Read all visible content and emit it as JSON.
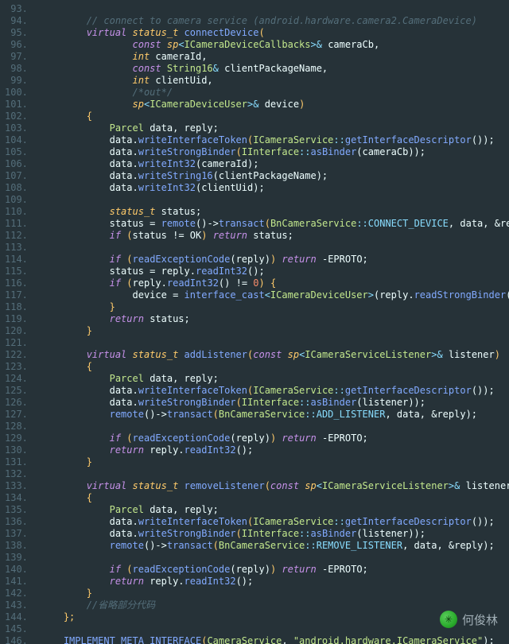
{
  "gutter": {
    "start": 93,
    "end": 146
  },
  "watermark": {
    "author": "何俊林",
    "icon_label": "wechat"
  },
  "code": {
    "l93": {
      "i": 2
    },
    "l94": {
      "i": 2,
      "cm": "// connect to camera service (android.hardware.camera2.CameraDevice)"
    },
    "l95": {
      "i": 2,
      "kw": "virtual ",
      "ty": "status_t ",
      "fn": "connectDevice",
      "pn": "("
    },
    "l96": {
      "i": 4,
      "kw": "const ",
      "ty": "sp",
      "pn1": "<",
      "cl": "ICameraDeviceCallbacks",
      "pn2": ">& ",
      "id": "cameraCb,",
      "trail": ""
    },
    "l97": {
      "i": 4,
      "ty": "int ",
      "id": "cameraId,"
    },
    "l98": {
      "i": 4,
      "kw": "const ",
      "cl": "String16",
      "pn": "& ",
      "id": "clientPackageName,"
    },
    "l99": {
      "i": 4,
      "ty": "int ",
      "id": "clientUid,"
    },
    "l100": {
      "i": 4,
      "cm": "/*out*/"
    },
    "l101": {
      "i": 4,
      "ty": "sp",
      "pn1": "<",
      "cl": "ICameraDeviceUser",
      "pn2": ">& ",
      "id": "device",
      "close": ")"
    },
    "l102": {
      "i": 2,
      "br": "{"
    },
    "l103": {
      "i": 3,
      "cl": "Parcel ",
      "id": "data, reply;"
    },
    "l104": {
      "i": 3,
      "a": "data.",
      "fn": "writeInterfaceToken",
      "op": "(",
      "cl": "ICameraService",
      "sc": "::",
      "fn2": "getInterfaceDescriptor",
      "rest": "());"
    },
    "l105": {
      "i": 3,
      "a": "data.",
      "fn": "writeStrongBinder",
      "op": "(",
      "cl": "IInterface",
      "sc": "::",
      "fn2": "asBinder",
      "rest": "(cameraCb));"
    },
    "l106": {
      "i": 3,
      "a": "data.",
      "fn": "writeInt32",
      "rest": "(cameraId);"
    },
    "l107": {
      "i": 3,
      "a": "data.",
      "fn": "writeString16",
      "rest": "(clientPackageName);"
    },
    "l108": {
      "i": 3,
      "a": "data.",
      "fn": "writeInt32",
      "rest": "(clientUid);"
    },
    "l109": {
      "i": 3
    },
    "l110": {
      "i": 3,
      "ty": "status_t ",
      "id": "status;"
    },
    "l111": {
      "i": 3,
      "a": "status = ",
      "fn": "remote",
      "mid": "()->",
      "fn2": "transact",
      "op": "(",
      "cl": "BnCameraService",
      "sc": "::",
      "cc": "CONNECT_DEVICE",
      "rest": ", data, &reply);"
    },
    "l112": {
      "i": 3,
      "kw": "if ",
      "op": "(",
      "id": "status != OK",
      "cp": ") ",
      "kw2": "return ",
      "ret": "status;"
    },
    "l113": {
      "i": 3
    },
    "l114": {
      "i": 3,
      "kw": "if ",
      "op": "(",
      "fn": "readExceptionCode",
      "mid": "(reply)",
      "cp": ") ",
      "kw2": "return ",
      "ret": "-EPROTO;"
    },
    "l115": {
      "i": 3,
      "a": "status = reply.",
      "fn": "readInt32",
      "rest": "();"
    },
    "l116": {
      "i": 3,
      "kw": "if ",
      "op": "(",
      "a": "reply.",
      "fn": "readInt32",
      "mid": "() != ",
      "num": "0",
      "cp": ") {"
    },
    "l117": {
      "i": 4,
      "a": "device = ",
      "fn": "interface_cast",
      "pn1": "<",
      "cl": "ICameraDeviceUser",
      "pn2": ">",
      "mid": "(reply.",
      "fn2": "readStrongBinder",
      "rest": "());"
    },
    "l118": {
      "i": 3,
      "br": "}"
    },
    "l119": {
      "i": 3,
      "kw": "return ",
      "id": "status;"
    },
    "l120": {
      "i": 2,
      "br": "}"
    },
    "l121": {
      "i": 2
    },
    "l122": {
      "i": 2,
      "kw": "virtual ",
      "ty": "status_t ",
      "fn": "addListener",
      "op": "(",
      "kw2": "const ",
      "ty2": "sp",
      "pn1": "<",
      "cl": "ICameraServiceListener",
      "pn2": ">& ",
      "id": "listener",
      "cp": ")"
    },
    "l123": {
      "i": 2,
      "br": "{"
    },
    "l124": {
      "i": 3,
      "cl": "Parcel ",
      "id": "data, reply;"
    },
    "l125": {
      "i": 3,
      "a": "data.",
      "fn": "writeInterfaceToken",
      "op": "(",
      "cl": "ICameraService",
      "sc": "::",
      "fn2": "getInterfaceDescriptor",
      "rest": "());"
    },
    "l126": {
      "i": 3,
      "a": "data.",
      "fn": "writeStrongBinder",
      "op": "(",
      "cl": "IInterface",
      "sc": "::",
      "fn2": "asBinder",
      "rest": "(listener));"
    },
    "l127": {
      "i": 3,
      "fn": "remote",
      "mid": "()->",
      "fn2": "transact",
      "op": "(",
      "cl": "BnCameraService",
      "sc": "::",
      "cc": "ADD_LISTENER",
      "rest": ", data, &reply);"
    },
    "l128": {
      "i": 3
    },
    "l129": {
      "i": 3,
      "kw": "if ",
      "op": "(",
      "fn": "readExceptionCode",
      "mid": "(reply)",
      "cp": ") ",
      "kw2": "return ",
      "ret": "-EPROTO;"
    },
    "l130": {
      "i": 3,
      "kw": "return ",
      "a": "reply.",
      "fn": "readInt32",
      "rest": "();"
    },
    "l131": {
      "i": 2,
      "br": "}"
    },
    "l132": {
      "i": 2
    },
    "l133": {
      "i": 2,
      "kw": "virtual ",
      "ty": "status_t ",
      "fn": "removeListener",
      "op": "(",
      "kw2": "const ",
      "ty2": "sp",
      "pn1": "<",
      "cl": "ICameraServiceListener",
      "pn2": ">& ",
      "id": "listener",
      "cp": ")"
    },
    "l134": {
      "i": 2,
      "br": "{"
    },
    "l135": {
      "i": 3,
      "cl": "Parcel ",
      "id": "data, reply;"
    },
    "l136": {
      "i": 3,
      "a": "data.",
      "fn": "writeInterfaceToken",
      "op": "(",
      "cl": "ICameraService",
      "sc": "::",
      "fn2": "getInterfaceDescriptor",
      "rest": "());"
    },
    "l137": {
      "i": 3,
      "a": "data.",
      "fn": "writeStrongBinder",
      "op": "(",
      "cl": "IInterface",
      "sc": "::",
      "fn2": "asBinder",
      "rest": "(listener));"
    },
    "l138": {
      "i": 3,
      "fn": "remote",
      "mid": "()->",
      "fn2": "transact",
      "op": "(",
      "cl": "BnCameraService",
      "sc": "::",
      "cc": "REMOVE_LISTENER",
      "rest": ", data, &reply);"
    },
    "l139": {
      "i": 3
    },
    "l140": {
      "i": 3,
      "kw": "if ",
      "op": "(",
      "fn": "readExceptionCode",
      "mid": "(reply)",
      "cp": ") ",
      "kw2": "return ",
      "ret": "-EPROTO;"
    },
    "l141": {
      "i": 3,
      "kw": "return ",
      "a": "reply.",
      "fn": "readInt32",
      "rest": "();"
    },
    "l142": {
      "i": 2,
      "br": "}"
    },
    "l143": {
      "i": 2,
      "cm": "//省略部分代码"
    },
    "l144": {
      "i": 1,
      "br": "};"
    },
    "l145": {
      "i": 1
    },
    "l146": {
      "i": 1,
      "fn": "IMPLEMENT_META_INTERFACE",
      "op": "(",
      "cl": "CameraService",
      "mid": ", ",
      "str": "\"android.hardware.ICameraService\"",
      "rest": ");"
    }
  }
}
